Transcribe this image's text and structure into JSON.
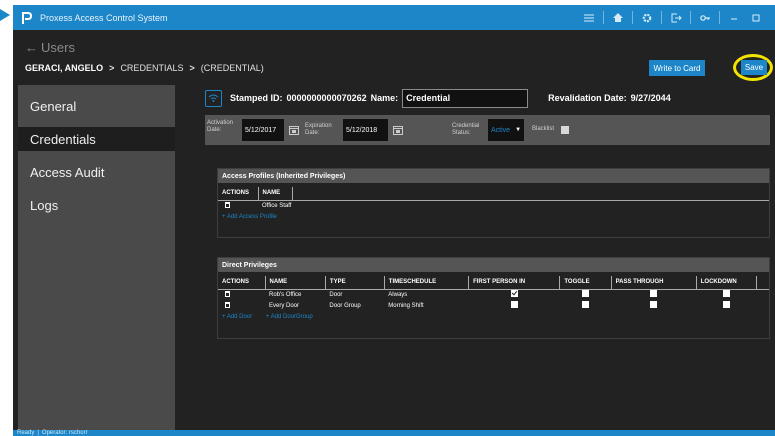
{
  "app": {
    "title": "Proxess Access Control System"
  },
  "titlebar_icons": [
    "menu-icon",
    "home-icon",
    "settings-icon",
    "logout-icon",
    "key-icon",
    "minimize-icon",
    "maximize-icon"
  ],
  "header": {
    "back_label": "Users",
    "breadcrumb": {
      "user": "GERACI, ANGELO",
      "sep": ">",
      "section": "CREDENTIALS",
      "item": "(CREDENTIAL)"
    },
    "write_to_card_label": "Write to Card",
    "save_label": "Save"
  },
  "sidebar": {
    "items": [
      {
        "label": "General",
        "active": false
      },
      {
        "label": "Credentials",
        "active": true
      },
      {
        "label": "Access Audit",
        "active": false
      },
      {
        "label": "Logs",
        "active": false
      }
    ]
  },
  "credential": {
    "stamped_id_label": "Stamped ID:",
    "stamped_id_value": "0000000000070262",
    "name_label": "Name:",
    "name_value": "Credential",
    "revalidation_label": "Revalidation Date:",
    "revalidation_value": "9/27/2044"
  },
  "dates": {
    "activation_label": "Activation Date:",
    "activation_value": "5/12/2017",
    "expiration_label": "Expiration Date:",
    "expiration_value": "5/12/2018",
    "status_label": "Credential Status:",
    "status_value": "Active",
    "blacklist_label": "Blacklist"
  },
  "access_profiles": {
    "title": "Access Profiles (Inherited Privileges)",
    "columns": [
      "ACTIONS",
      "NAME"
    ],
    "rows": [
      {
        "name": "Office Staff"
      }
    ],
    "add_label": "+ Add Access Profile"
  },
  "direct_privileges": {
    "title": "Direct Privileges",
    "columns": [
      "ACTIONS",
      "NAME",
      "TYPE",
      "TIMESCHEDULE",
      "FIRST PERSON IN",
      "TOGGLE",
      "PASS THROUGH",
      "LOCKDOWN"
    ],
    "rows": [
      {
        "name": "Rob's Office",
        "type": "Door",
        "schedule": "Always",
        "first_person_in": true,
        "toggle": false,
        "pass_through": false,
        "lockdown": false
      },
      {
        "name": "Every Door",
        "type": "Door Group",
        "schedule": "Morning Shift",
        "first_person_in": false,
        "toggle": false,
        "pass_through": false,
        "lockdown": false
      }
    ],
    "add_door_label": "+ Add Door",
    "add_doorgroup_label": "+ Add DoorGroup"
  },
  "statusbar": {
    "state": "Ready",
    "operator": "Operator: rschorr"
  },
  "colors": {
    "accent": "#1c86c8",
    "highlight_ring": "#f2e400",
    "panel": "#555555",
    "background": "#222222",
    "sidebar": "#4a4a4a"
  }
}
